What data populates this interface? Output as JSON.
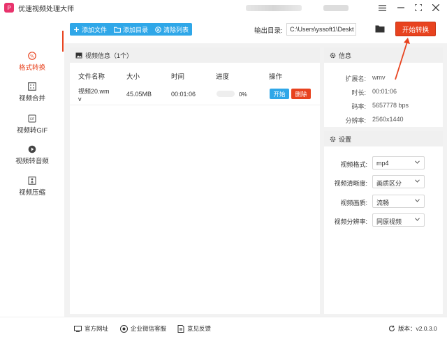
{
  "app": {
    "title": "优速视频处理大师",
    "logo_char": "P"
  },
  "sidebar": {
    "items": [
      {
        "label": "格式转换",
        "icon": "format-convert-icon"
      },
      {
        "label": "视频合并",
        "icon": "merge-icon"
      },
      {
        "label": "视频转GIF",
        "icon": "gif-icon"
      },
      {
        "label": "视频转音频",
        "icon": "audio-icon"
      },
      {
        "label": "视频压缩",
        "icon": "compress-icon"
      }
    ]
  },
  "toolbar": {
    "add_file": "添加文件",
    "add_dir": "添加目录",
    "clear_list": "清除列表",
    "output_label": "输出目录:",
    "output_path": "C:\\Users\\yssoft1\\Deskt",
    "start_all": "开始转换"
  },
  "list": {
    "header": "视频信息（1个）",
    "columns": [
      "文件名称",
      "大小",
      "时间",
      "进度",
      "操作"
    ],
    "rows": [
      {
        "name_line1": "视频20.wm",
        "name_line2": "v",
        "size": "45.05MB",
        "time": "00:01:06",
        "progress": "0%",
        "start": "开始",
        "delete": "删除"
      }
    ]
  },
  "info": {
    "header": "信息",
    "ext_key": "扩展名:",
    "ext_val": "wmv",
    "dur_key": "时长:",
    "dur_val": "00:01:06",
    "bitrate_key": "码率:",
    "bitrate_val": "5657778 bps",
    "res_key": "分辨率:",
    "res_val": "2560x1440"
  },
  "settings": {
    "header": "设置",
    "format_key": "视频格式:",
    "format_val": "mp4",
    "clarity_key": "视频清晰度:",
    "clarity_val": "画质区分",
    "quality_key": "视频画质:",
    "quality_val": "流畅",
    "resolution_key": "视频分辨率:",
    "resolution_val": "同原视频"
  },
  "footer": {
    "website": "官方网址",
    "wechat": "企业微信客服",
    "feedback": "意见反馈",
    "version_label": "版本：",
    "version": "v2.0.3.0"
  },
  "colors": {
    "accent": "#e8431f",
    "blue": "#2fa7e8"
  }
}
